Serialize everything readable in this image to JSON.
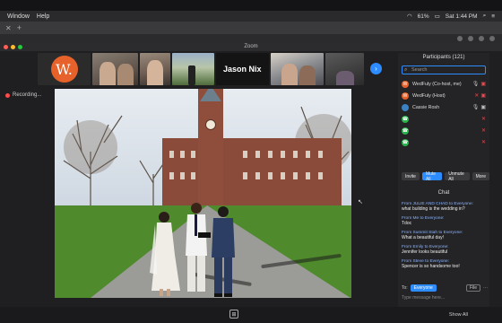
{
  "menubar": {
    "items": [
      "Window",
      "Help"
    ],
    "battery": "61%",
    "clock": "Sat 1:44 PM"
  },
  "zoom_window": {
    "title": "Zoom",
    "recording_label": "Recording...",
    "gallery": {
      "tile_name": "Jason Nix",
      "logo_letter": "W."
    }
  },
  "participants": {
    "title": "Participants (121)",
    "search_placeholder": "Search",
    "list": [
      {
        "name": "WedFuly (Co-host, me)",
        "avatar_color": "#e7622a",
        "avatar_text": "W"
      },
      {
        "name": "WedFuly (Host)",
        "avatar_color": "#e7622a",
        "avatar_text": "W"
      },
      {
        "name": "Cassie Rosh",
        "avatar_color": "#3b82c4",
        "avatar_text": ""
      },
      {
        "name": "",
        "avatar_color": "#2bb24c",
        "avatar_text": ""
      },
      {
        "name": "",
        "avatar_color": "#2bb24c",
        "avatar_text": ""
      },
      {
        "name": "",
        "avatar_color": "#2bb24c",
        "avatar_text": ""
      }
    ],
    "buttons": {
      "invite": "Invite",
      "mute_all": "Mute All",
      "unmute_all": "Unmute All",
      "more": "More"
    }
  },
  "chat": {
    "title": "Chat",
    "messages": [
      {
        "from": "From JULIE AND CHAD to Everyone:",
        "text": "what building is the wedding in?"
      },
      {
        "from": "From Me to Everyone:",
        "text": "Tdoc"
      },
      {
        "from": "From Summit Stah to Everyone:",
        "text": "What a beautiful day!"
      },
      {
        "from": "From Emily to Everyone:",
        "text": "Jennifer looks beautiful"
      },
      {
        "from": "From Steve to Everyone:",
        "text": "Spencer is so handsome too!"
      }
    ],
    "to_label": "To:",
    "to_value": "Everyone",
    "file_label": "File",
    "input_placeholder": "Type message here..."
  },
  "toolbar": {
    "show_all": "Show All"
  }
}
